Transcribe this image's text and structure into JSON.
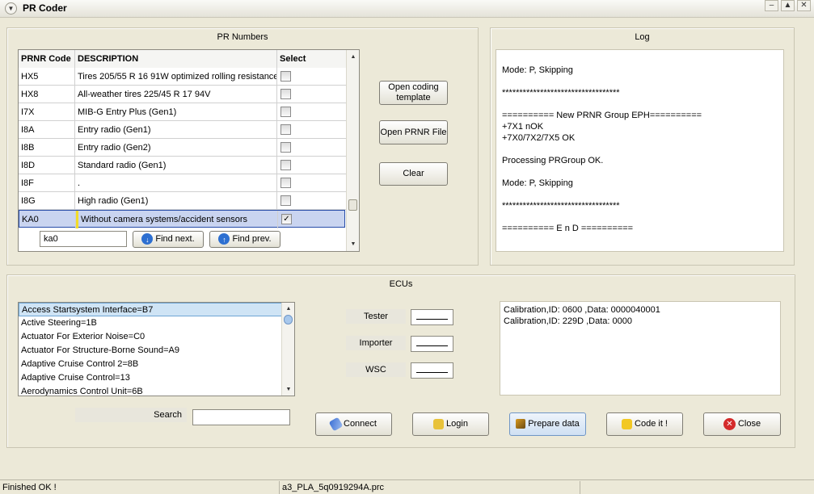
{
  "window": {
    "title": "PR Coder"
  },
  "pr_panel": {
    "title": "PR Numbers",
    "columns": [
      "PRNR Code",
      "DESCRIPTION",
      "Select"
    ],
    "rows": [
      {
        "code": "HX5",
        "description": "Tires 205/55 R 16 91W  optimized rolling resistance",
        "checked": false
      },
      {
        "code": "HX8",
        "description": "All-weather tires 225/45 R 17 94V",
        "checked": false
      },
      {
        "code": "I7X",
        "description": "MIB-G Entry Plus (Gen1)",
        "checked": false
      },
      {
        "code": "I8A",
        "description": "Entry radio (Gen1)",
        "checked": false
      },
      {
        "code": "I8B",
        "description": "Entry radio (Gen2)",
        "checked": false
      },
      {
        "code": "I8D",
        "description": "Standard radio (Gen1)",
        "checked": false
      },
      {
        "code": "I8F",
        "description": ".",
        "checked": false
      },
      {
        "code": "I8G",
        "description": "High radio (Gen1)",
        "checked": false
      },
      {
        "code": "KA0",
        "description": "Without camera systems/accident sensors",
        "checked": true
      }
    ],
    "find_value": "ka0",
    "find_next_label": "Find next.",
    "find_prev_label": "Find prev."
  },
  "buttons": {
    "open_template": "Open coding template",
    "open_prnr": "Open PRNR File",
    "clear": "Clear"
  },
  "log_panel": {
    "title": "Log",
    "lines": [
      "Mode: P, Skipping",
      "",
      "**********************************",
      "",
      "========== New PRNR Group EPH==========",
      "+7X1 nOK",
      "+7X0/7X2/7X5 OK",
      "",
      "Processing PRGroup OK.",
      "",
      "Mode: P, Skipping",
      "",
      "**********************************",
      "",
      "========== E n D =========="
    ]
  },
  "ecu_panel": {
    "title": "ECUs",
    "items": [
      "Access Startsystem Interface=B7",
      "Active Steering=1B",
      "Actuator For Exterior Noise=C0",
      "Actuator For Structure-Borne Sound=A9",
      "Adaptive Cruise Control 2=8B",
      "Adaptive Cruise Control=13",
      "Aerodynamics Control Unit=6B"
    ],
    "tester_label": "Tester",
    "importer_label": "Importer",
    "wsc_label": "WSC",
    "search_label": "Search",
    "search_value": "",
    "calibration": [
      "Calibration,ID: 0600 ,Data: 0000040001",
      "Calibration,ID: 229D ,Data: 0000"
    ]
  },
  "actions": {
    "connect": "Connect",
    "login": "Login",
    "prepare": "Prepare data",
    "code": "Code it !",
    "close": "Close"
  },
  "status": {
    "left": "Finished OK !",
    "file": "a3_PLA_5q0919294A.prc"
  }
}
